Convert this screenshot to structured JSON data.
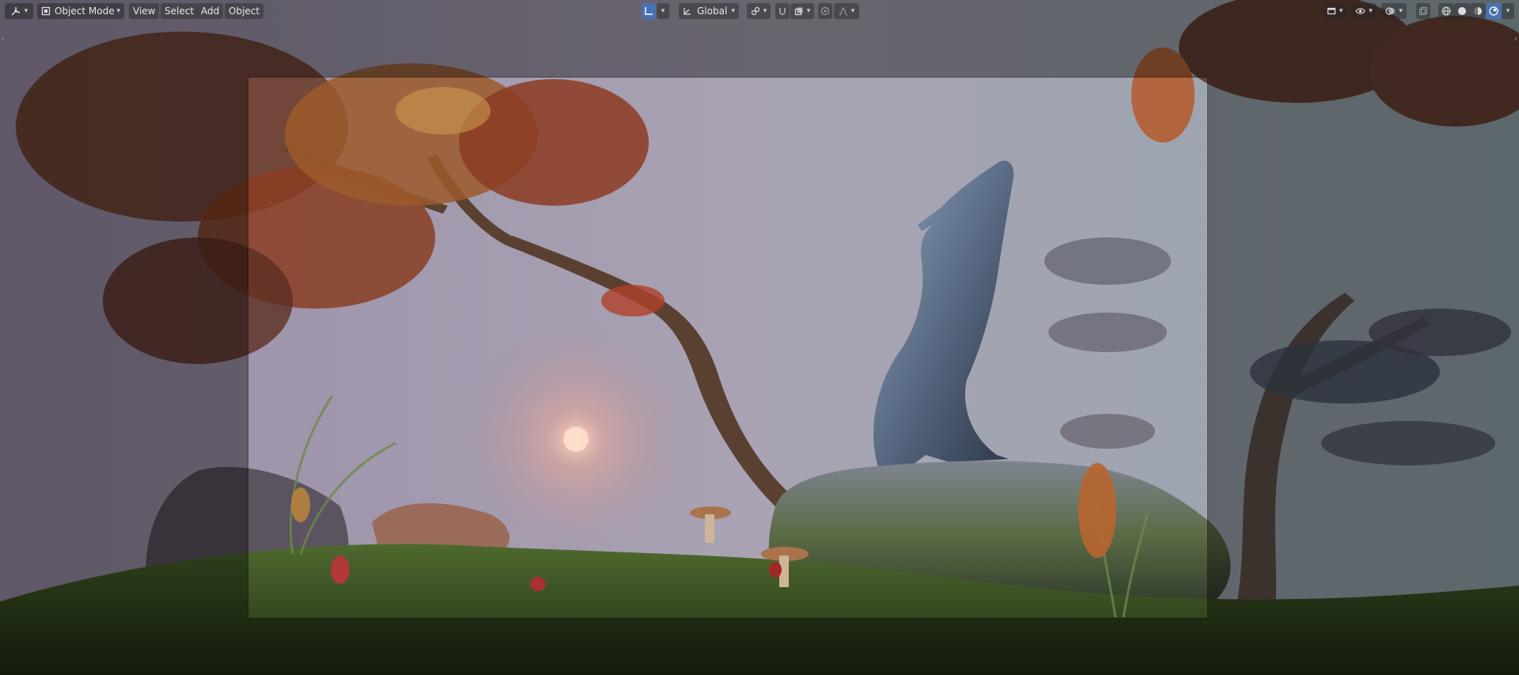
{
  "app": {
    "name": "Blender 3D Viewport"
  },
  "header": {
    "editor_type_icon": "editor-type-icon",
    "mode": {
      "label": "Object Mode",
      "icon": "object-mode-icon"
    },
    "menus": [
      "View",
      "Select",
      "Add",
      "Object"
    ],
    "transform_orientation": {
      "label": "Global",
      "icon": "orientation-axes-icon"
    },
    "pivot_icon": "pivot-point-icon",
    "snap_icon": "snap-magnet-icon",
    "snap_target_icon": "snap-target-icon",
    "proportional_icon": "proportional-edit-icon",
    "falloff_icon": "falloff-curve-icon",
    "right": {
      "view_object_types_icon": "view-object-types-icon",
      "gizmo_icon": "gizmo-visibility-icon",
      "overlay_icon": "overlay-icon",
      "xray_icon": "xray-toggle-icon",
      "shading_modes": [
        "wireframe",
        "solid",
        "material-preview",
        "rendered"
      ],
      "active_shading": "rendered"
    }
  },
  "colors": {
    "accent": "#4772b3",
    "header_bg": "#2b2b2b",
    "text": "#e6e6e6"
  },
  "scene": {
    "description_objects": [
      "tree",
      "wolf-statue",
      "rocks",
      "mushrooms",
      "grass",
      "sun-glow"
    ]
  }
}
